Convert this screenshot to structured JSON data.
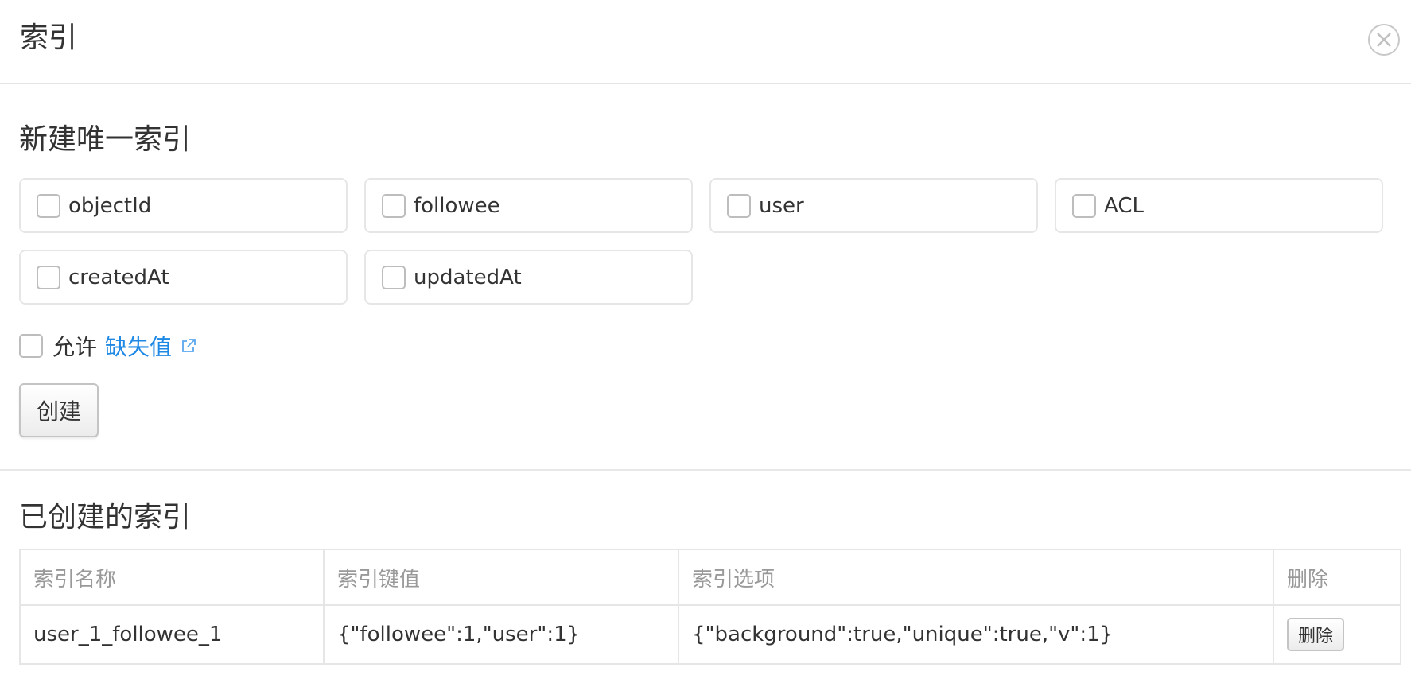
{
  "modal": {
    "title": "索引"
  },
  "create_section": {
    "title": "新建唯一索引",
    "fields": [
      {
        "label": "objectId",
        "checked": false
      },
      {
        "label": "followee",
        "checked": false
      },
      {
        "label": "user",
        "checked": false
      },
      {
        "label": "ACL",
        "checked": false
      },
      {
        "label": "createdAt",
        "checked": false
      },
      {
        "label": "updatedAt",
        "checked": false
      }
    ],
    "allow_label": "允许",
    "missing_link_label": "缺失值",
    "create_button_label": "创建"
  },
  "existing_section": {
    "title": "已创建的索引",
    "columns": [
      "索引名称",
      "索引键值",
      "索引选项",
      "删除"
    ],
    "rows": [
      {
        "name": "user_1_followee_1",
        "keys": "{\"followee\":1,\"user\":1}",
        "options": "{\"background\":true,\"unique\":true,\"v\":1}",
        "delete_label": "删除"
      }
    ]
  },
  "colors": {
    "link": "#1e88e5",
    "border": "#e6e6e6",
    "muted_text": "#999999"
  },
  "icons": {
    "close": "close-icon",
    "external_link": "external-link-icon"
  }
}
